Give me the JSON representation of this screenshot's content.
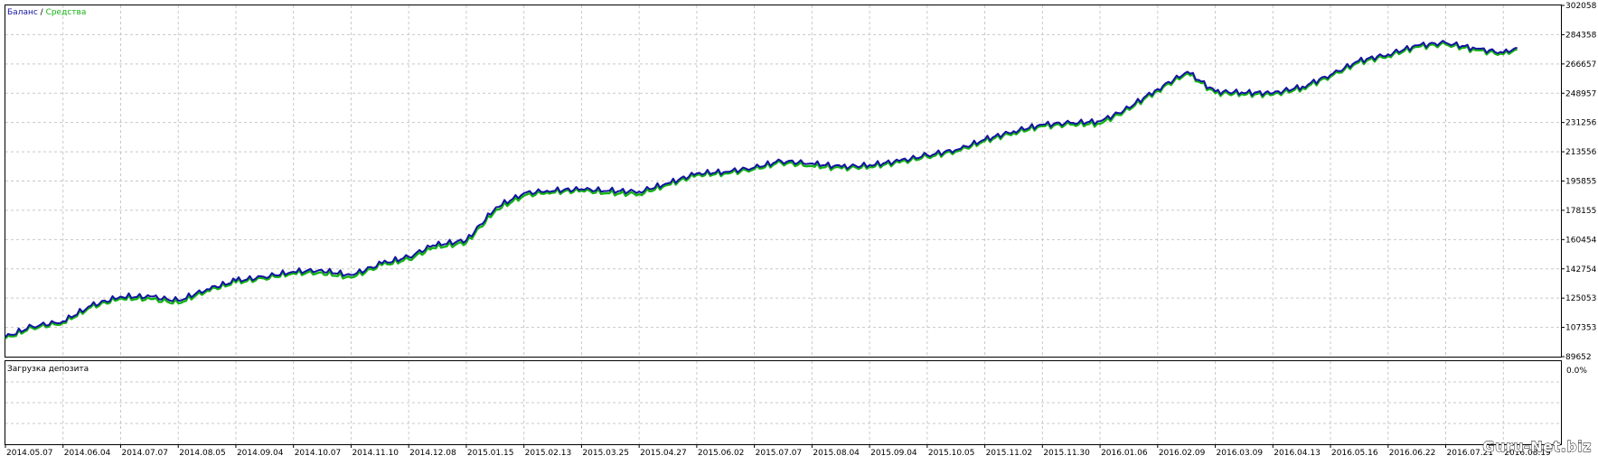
{
  "legend": {
    "balance": "Баланс",
    "separator": " / ",
    "equity": "Средства"
  },
  "subwindow_label": "Загрузка депозита",
  "subwindow_value": "0.0%",
  "watermark": "Guru-Net.biz",
  "colors": {
    "balance": "#1414a0",
    "equity": "#16b216",
    "grid": "#c8c8c8",
    "frame": "#000000",
    "background": "#ffffff"
  },
  "chart_data": {
    "type": "line",
    "title": "",
    "xlabel": "",
    "ylabel": "",
    "ylim": [
      89652,
      302058
    ],
    "y_ticks": [
      "302058",
      "284358",
      "266657",
      "248957",
      "231256",
      "213556",
      "195855",
      "178155",
      "160454",
      "142754",
      "125053",
      "107353",
      "89652"
    ],
    "x_ticks": [
      "2014.05.07",
      "2014.06.04",
      "2014.07.07",
      "2014.08.05",
      "2014.09.04",
      "2014.10.07",
      "2014.11.10",
      "2014.12.08",
      "2015.01.15",
      "2015.02.13",
      "2015.03.25",
      "2015.04.27",
      "2015.06.02",
      "2015.07.07",
      "2015.08.04",
      "2015.09.04",
      "2015.10.05",
      "2015.11.02",
      "2015.11.30",
      "2016.01.06",
      "2016.02.09",
      "2016.03.09",
      "2016.04.13",
      "2016.05.16",
      "2016.06.22",
      "2016.07.21",
      "2016.08.19"
    ],
    "grid": true,
    "series": [
      {
        "name": "Баланс",
        "x": [
          "2014.05.07",
          "2014.05.20",
          "2014.06.04",
          "2014.06.20",
          "2014.07.07",
          "2014.07.22",
          "2014.08.05",
          "2014.08.20",
          "2014.09.04",
          "2014.09.20",
          "2014.10.07",
          "2014.10.22",
          "2014.11.10",
          "2014.11.25",
          "2014.12.08",
          "2014.12.24",
          "2015.01.15",
          "2015.01.30",
          "2015.02.13",
          "2015.03.01",
          "2015.03.25",
          "2015.04.10",
          "2015.04.27",
          "2015.05.15",
          "2015.06.02",
          "2015.06.20",
          "2015.07.07",
          "2015.07.20",
          "2015.08.04",
          "2015.08.20",
          "2015.09.04",
          "2015.09.20",
          "2015.10.05",
          "2015.10.20",
          "2015.11.02",
          "2015.11.16",
          "2015.11.30",
          "2015.12.18",
          "2016.01.06",
          "2016.01.20",
          "2016.02.09",
          "2016.02.24",
          "2016.03.09",
          "2016.03.25",
          "2016.04.13",
          "2016.04.30",
          "2016.05.16",
          "2016.06.03",
          "2016.06.22",
          "2016.07.07",
          "2016.07.21",
          "2016.08.05",
          "2016.08.19",
          "2016.08.26"
        ],
        "values": [
          101500,
          108000,
          111000,
          120500,
          126000,
          126000,
          123500,
          130500,
          135500,
          138000,
          141000,
          142000,
          139000,
          146000,
          150000,
          157000,
          160000,
          180000,
          188500,
          190000,
          191000,
          190000,
          189500,
          194500,
          200500,
          201500,
          204000,
          208000,
          206500,
          204500,
          205500,
          208000,
          211500,
          215000,
          221000,
          226000,
          230000,
          231000,
          232000,
          238500,
          251500,
          262000,
          250000,
          249500,
          249000,
          253000,
          260000,
          268500,
          272500,
          278000,
          279500,
          276000,
          273500,
          276500
        ]
      },
      {
        "name": "Средства",
        "x": [
          "2014.05.07",
          "2014.05.20",
          "2014.06.04",
          "2014.06.20",
          "2014.07.07",
          "2014.07.22",
          "2014.08.05",
          "2014.08.20",
          "2014.09.04",
          "2014.09.20",
          "2014.10.07",
          "2014.10.22",
          "2014.11.10",
          "2014.11.25",
          "2014.12.08",
          "2014.12.24",
          "2015.01.15",
          "2015.01.30",
          "2015.02.13",
          "2015.03.01",
          "2015.03.25",
          "2015.04.10",
          "2015.04.27",
          "2015.05.15",
          "2015.06.02",
          "2015.06.20",
          "2015.07.07",
          "2015.07.20",
          "2015.08.04",
          "2015.08.20",
          "2015.09.04",
          "2015.09.20",
          "2015.10.05",
          "2015.10.20",
          "2015.11.02",
          "2015.11.16",
          "2015.11.30",
          "2015.12.18",
          "2016.01.06",
          "2016.01.20",
          "2016.02.09",
          "2016.02.24",
          "2016.03.09",
          "2016.03.25",
          "2016.04.13",
          "2016.04.30",
          "2016.05.16",
          "2016.06.03",
          "2016.06.22",
          "2016.07.07",
          "2016.07.21",
          "2016.08.05",
          "2016.08.19",
          "2016.08.26"
        ],
        "values": [
          100500,
          107000,
          110000,
          119500,
          125000,
          124500,
          122000,
          129500,
          134500,
          137000,
          140000,
          140500,
          137500,
          145000,
          148500,
          155500,
          158500,
          178500,
          187000,
          189000,
          190000,
          188500,
          188000,
          193500,
          199500,
          200500,
          203000,
          207000,
          205000,
          203500,
          204500,
          207000,
          210500,
          214000,
          220000,
          225000,
          229000,
          230000,
          230500,
          237500,
          250500,
          261000,
          249000,
          248500,
          248000,
          252000,
          259000,
          267500,
          271500,
          277000,
          278500,
          275000,
          272500,
          275500
        ]
      }
    ],
    "deposit_load": {
      "ylim": [
        0,
        0
      ],
      "y_ticks": [
        "0.0%"
      ]
    }
  }
}
